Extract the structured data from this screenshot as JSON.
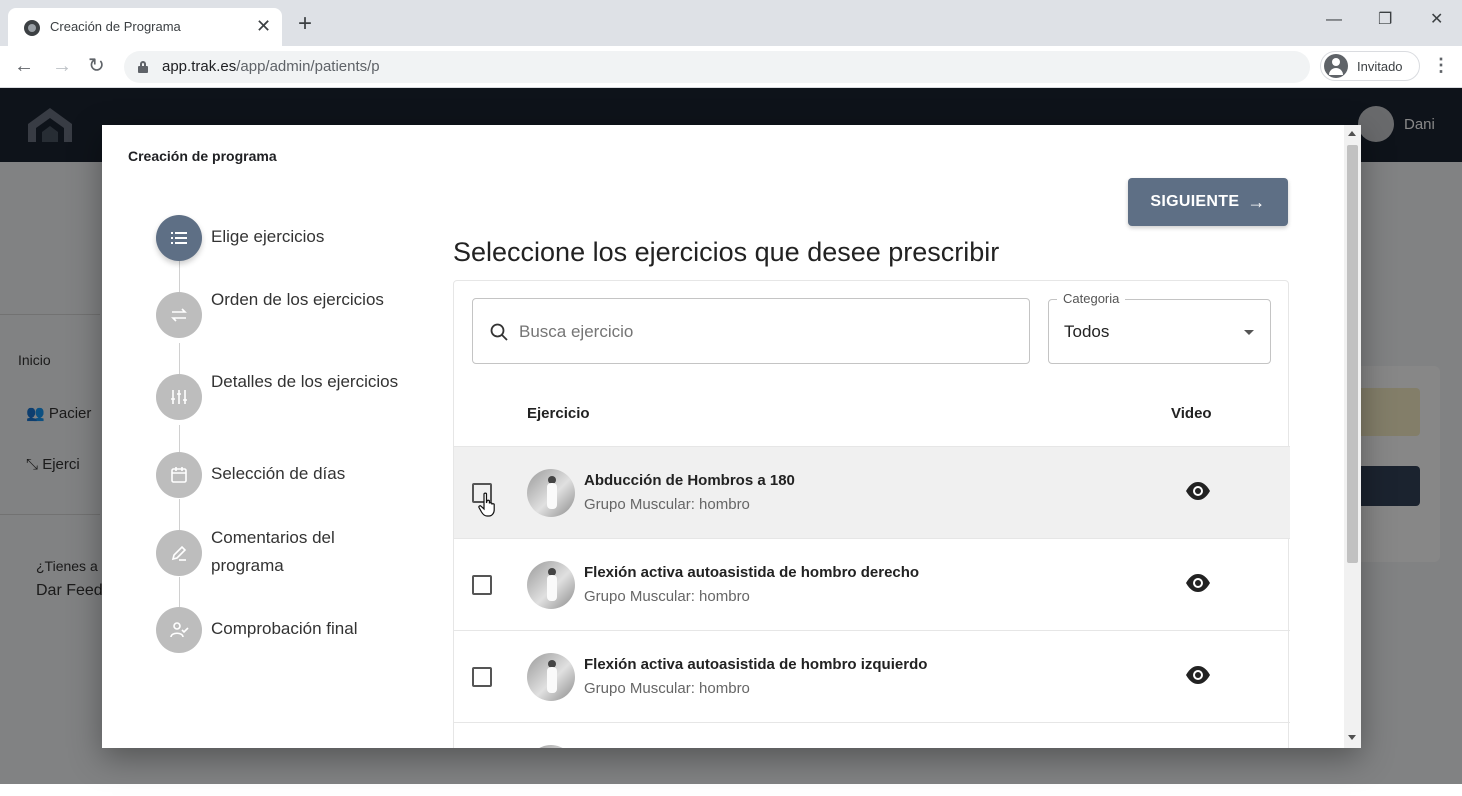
{
  "browser": {
    "tab_title": "Creación de Programa",
    "url_host": "app.trak.es",
    "url_path": "/app/admin/patients/p",
    "profile_label": "Invitado",
    "icons": {
      "back": "arrow-left-icon",
      "forward": "arrow-right-icon",
      "reload": "reload-icon",
      "lock": "lock-icon",
      "menu": "kebab-menu-icon"
    }
  },
  "app": {
    "user_name": "Dani",
    "nav_title": "Inicio",
    "nav_items": [
      {
        "label": "Pacier",
        "icon": "users-icon"
      },
      {
        "label": "Ejerci",
        "icon": "exercise-icon"
      }
    ],
    "feedback_question": "¿Tienes a",
    "feedback_link": "Dar Feed"
  },
  "modal": {
    "title": "Creación de programa",
    "next_button": "SIGUIENTE",
    "heading": "Seleccione los ejercicios que desee prescribir",
    "steps": [
      {
        "label": "Elige ejercicios",
        "icon": "list-icon",
        "active": true
      },
      {
        "label": "Orden de los ejercicios",
        "icon": "swap-icon",
        "active": false
      },
      {
        "label": "Detalles de los ejercicios",
        "icon": "sliders-icon",
        "active": false
      },
      {
        "label": "Selección de días",
        "icon": "calendar-icon",
        "active": false
      },
      {
        "label": "Comentarios del programa",
        "icon": "pencil-icon",
        "active": false
      },
      {
        "label": "Comprobación final",
        "icon": "user-check-icon",
        "active": false
      }
    ],
    "search": {
      "placeholder": "Busca ejercicio",
      "value": ""
    },
    "category": {
      "label": "Categoria",
      "value": "Todos"
    },
    "table": {
      "columns": [
        "Ejercicio",
        "Video"
      ],
      "rows": [
        {
          "name": "Abducción de Hombros a 180",
          "group": "Grupo Muscular: hombro",
          "checked": false,
          "hover": true
        },
        {
          "name": "Flexión activa autoasistida de hombro derecho",
          "group": "Grupo Muscular: hombro",
          "checked": false,
          "hover": false
        },
        {
          "name": "Flexión activa autoasistida de hombro izquierdo",
          "group": "Grupo Muscular: hombro",
          "checked": false,
          "hover": false
        }
      ]
    },
    "colors": {
      "primary": "#5e6f85",
      "step_inactive": "#bdbdbd",
      "app_header": "#1c2432"
    }
  }
}
